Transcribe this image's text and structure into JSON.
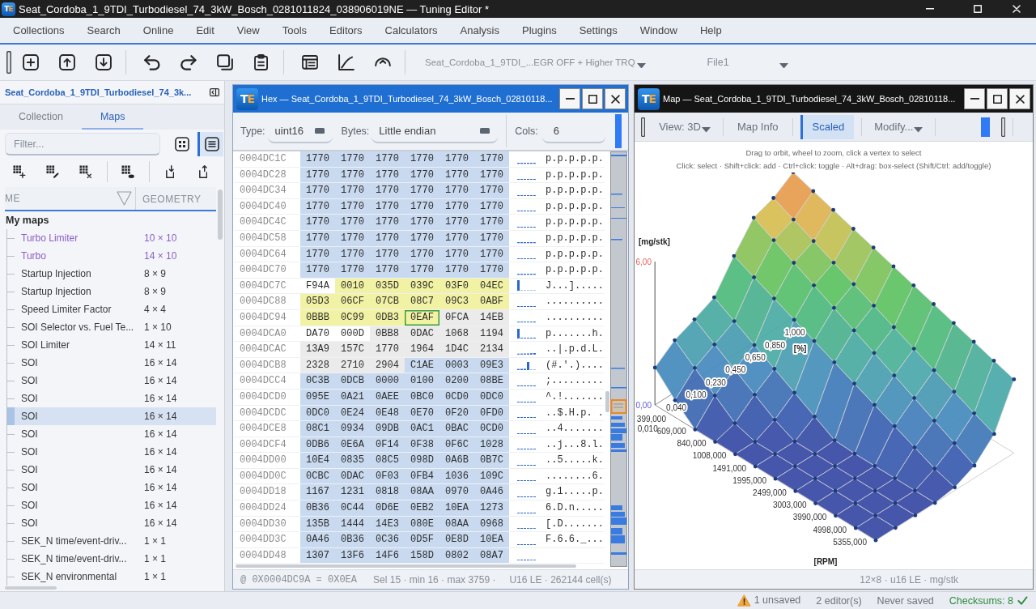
{
  "window": {
    "logo": "TE",
    "title": "Seat_Cordoba_1_9TDI_Turbodiesel_74_3kW_Bosch_0281011824_038906019NE — Tuning Editor *"
  },
  "menu": [
    "Collections",
    "Search",
    "Online",
    "Edit",
    "View",
    "Tools",
    "Editors",
    "Calculators",
    "Analysis",
    "Plugins",
    "Settings",
    "Window",
    "Help"
  ],
  "toolbar": {
    "project": "Seat_Cordoba_1_9TDI_...EGR OFF + Higher TRQ",
    "file": "File1"
  },
  "sidebar": {
    "title": "Seat_Cordoba_1_9TDI_Turbodiesel_74_3k...",
    "tabs": [
      {
        "label": "Collection",
        "selected": false
      },
      {
        "label": "Maps",
        "selected": true
      }
    ],
    "filter": {
      "placeholder": "Filter..."
    },
    "view_modes": [
      {
        "kind": "grid",
        "selected": false
      },
      {
        "kind": "list",
        "selected": true
      }
    ],
    "columns": [
      "ME",
      "GEOMETRY"
    ],
    "tree": [
      {
        "label": "My maps",
        "children": [
          {
            "name": "Turbo Limiter",
            "geometry": "10 × 10",
            "color": "#8b5fc7",
            "selected": false
          },
          {
            "name": "Turbo",
            "geometry": "14 × 10",
            "color": "#8b5fc7",
            "selected": false
          },
          {
            "name": "Startup Injection",
            "geometry": "8 × 9",
            "color": "#383838",
            "selected": false
          },
          {
            "name": "Startup Injection",
            "geometry": "8 × 9",
            "color": "#383838",
            "selected": false
          },
          {
            "name": "Speed Limiter Factor",
            "geometry": "4 × 4",
            "color": "#383838",
            "selected": false
          },
          {
            "name": "SOI Selector vs. Fuel Te...",
            "geometry": "1 × 10",
            "color": "#383838",
            "selected": false
          },
          {
            "name": "SOI Limiter",
            "geometry": "14 × 11",
            "color": "#383838",
            "selected": false
          },
          {
            "name": "SOI",
            "geometry": "16 × 14",
            "color": "#383838",
            "selected": false
          },
          {
            "name": "SOI",
            "geometry": "16 × 14",
            "color": "#383838",
            "selected": false
          },
          {
            "name": "SOI",
            "geometry": "16 × 14",
            "color": "#383838",
            "selected": false
          },
          {
            "name": "SOI",
            "geometry": "16 × 14",
            "color": "#383838",
            "selected": true
          },
          {
            "name": "SOI",
            "geometry": "16 × 14",
            "color": "#383838",
            "selected": false
          },
          {
            "name": "SOI",
            "geometry": "16 × 14",
            "color": "#383838",
            "selected": false
          },
          {
            "name": "SOI",
            "geometry": "16 × 14",
            "color": "#383838",
            "selected": false
          },
          {
            "name": "SOI",
            "geometry": "16 × 14",
            "color": "#383838",
            "selected": false
          },
          {
            "name": "SOI",
            "geometry": "16 × 14",
            "color": "#383838",
            "selected": false
          },
          {
            "name": "SOI",
            "geometry": "16 × 14",
            "color": "#383838",
            "selected": false
          },
          {
            "name": "SEK_N time/event-driv...",
            "geometry": "1 × 1",
            "color": "#383838",
            "selected": false
          },
          {
            "name": "SEK_N time/event-driv...",
            "geometry": "1 × 1",
            "color": "#383838",
            "selected": false
          },
          {
            "name": "SEK_N environmental",
            "geometry": "1 × 1",
            "color": "#383838",
            "selected": false
          }
        ]
      }
    ]
  },
  "hex": {
    "logo": "TE",
    "title": "Hex — Seat_Cordoba_1_9TDI_Turbodiesel_74_3kW_Bosch_02810118...",
    "controls": [
      {
        "kind": "dropdown",
        "label": "Type:",
        "value": "uint16"
      },
      {
        "kind": "dropdown",
        "label": "Bytes:",
        "value": "Little endian"
      },
      {
        "kind": "field",
        "label": "Cols:",
        "value": "6"
      }
    ],
    "rows": [
      {
        "address": "0004DC1C",
        "ascii": "p.p.p.p.p.",
        "cells": [
          {
            "value": "1770",
            "kind": "map",
            "selected": false,
            "cursor": false
          },
          {
            "value": "1770",
            "kind": "map",
            "selected": false,
            "cursor": false
          },
          {
            "value": "1770",
            "kind": "map",
            "selected": false,
            "cursor": false
          },
          {
            "value": "1770",
            "kind": "map",
            "selected": false,
            "cursor": false
          },
          {
            "value": "1770",
            "kind": "map",
            "selected": false,
            "cursor": false
          },
          {
            "value": "1770",
            "kind": "map",
            "selected": false,
            "cursor": false
          }
        ]
      },
      {
        "address": "0004DC28",
        "ascii": "p.p.p.p.p.",
        "cells": [
          {
            "value": "1770",
            "kind": "map",
            "selected": false,
            "cursor": false
          },
          {
            "value": "1770",
            "kind": "map",
            "selected": false,
            "cursor": false
          },
          {
            "value": "1770",
            "kind": "map",
            "selected": false,
            "cursor": false
          },
          {
            "value": "1770",
            "kind": "map",
            "selected": false,
            "cursor": false
          },
          {
            "value": "1770",
            "kind": "map",
            "selected": false,
            "cursor": false
          },
          {
            "value": "1770",
            "kind": "map",
            "selected": false,
            "cursor": false
          }
        ]
      },
      {
        "address": "0004DC34",
        "ascii": "p.p.p.p.p.",
        "cells": [
          {
            "value": "1770",
            "kind": "map",
            "selected": false,
            "cursor": false
          },
          {
            "value": "1770",
            "kind": "map",
            "selected": false,
            "cursor": false
          },
          {
            "value": "1770",
            "kind": "map",
            "selected": false,
            "cursor": false
          },
          {
            "value": "1770",
            "kind": "map",
            "selected": false,
            "cursor": false
          },
          {
            "value": "1770",
            "kind": "map",
            "selected": false,
            "cursor": false
          },
          {
            "value": "1770",
            "kind": "map",
            "selected": false,
            "cursor": false
          }
        ]
      },
      {
        "address": "0004DC40",
        "ascii": "p.p.p.p.p.",
        "cells": [
          {
            "value": "1770",
            "kind": "map",
            "selected": false,
            "cursor": false
          },
          {
            "value": "1770",
            "kind": "map",
            "selected": false,
            "cursor": false
          },
          {
            "value": "1770",
            "kind": "map",
            "selected": false,
            "cursor": false
          },
          {
            "value": "1770",
            "kind": "map",
            "selected": false,
            "cursor": false
          },
          {
            "value": "1770",
            "kind": "map",
            "selected": false,
            "cursor": false
          },
          {
            "value": "1770",
            "kind": "map",
            "selected": false,
            "cursor": false
          }
        ]
      },
      {
        "address": "0004DC4C",
        "ascii": "p.p.p.p.p.",
        "cells": [
          {
            "value": "1770",
            "kind": "map",
            "selected": false,
            "cursor": false
          },
          {
            "value": "1770",
            "kind": "map",
            "selected": false,
            "cursor": false
          },
          {
            "value": "1770",
            "kind": "map",
            "selected": false,
            "cursor": false
          },
          {
            "value": "1770",
            "kind": "map",
            "selected": false,
            "cursor": false
          },
          {
            "value": "1770",
            "kind": "map",
            "selected": false,
            "cursor": false
          },
          {
            "value": "1770",
            "kind": "map",
            "selected": false,
            "cursor": false
          }
        ]
      },
      {
        "address": "0004DC58",
        "ascii": "p.p.p.p.p.",
        "cells": [
          {
            "value": "1770",
            "kind": "map",
            "selected": false,
            "cursor": false
          },
          {
            "value": "1770",
            "kind": "map",
            "selected": false,
            "cursor": false
          },
          {
            "value": "1770",
            "kind": "map",
            "selected": false,
            "cursor": false
          },
          {
            "value": "1770",
            "kind": "map",
            "selected": false,
            "cursor": false
          },
          {
            "value": "1770",
            "kind": "map",
            "selected": false,
            "cursor": false
          },
          {
            "value": "1770",
            "kind": "map",
            "selected": false,
            "cursor": false
          }
        ]
      },
      {
        "address": "0004DC64",
        "ascii": "p.p.p.p.p.",
        "cells": [
          {
            "value": "1770",
            "kind": "map",
            "selected": false,
            "cursor": false
          },
          {
            "value": "1770",
            "kind": "map",
            "selected": false,
            "cursor": false
          },
          {
            "value": "1770",
            "kind": "map",
            "selected": false,
            "cursor": false
          },
          {
            "value": "1770",
            "kind": "map",
            "selected": false,
            "cursor": false
          },
          {
            "value": "1770",
            "kind": "map",
            "selected": false,
            "cursor": false
          },
          {
            "value": "1770",
            "kind": "map",
            "selected": false,
            "cursor": false
          }
        ]
      },
      {
        "address": "0004DC70",
        "ascii": "p.p.p.p.p.",
        "cells": [
          {
            "value": "1770",
            "kind": "map",
            "selected": false,
            "cursor": false
          },
          {
            "value": "1770",
            "kind": "map",
            "selected": false,
            "cursor": false
          },
          {
            "value": "1770",
            "kind": "map",
            "selected": false,
            "cursor": false
          },
          {
            "value": "1770",
            "kind": "map",
            "selected": false,
            "cursor": false
          },
          {
            "value": "1770",
            "kind": "map",
            "selected": false,
            "cursor": false
          },
          {
            "value": "1770",
            "kind": "map",
            "selected": false,
            "cursor": false
          }
        ]
      },
      {
        "address": "0004DC7C",
        "ascii": "J...].....",
        "cells": [
          {
            "value": "F94A",
            "kind": "plain",
            "selected": false,
            "cursor": false
          },
          {
            "value": "0010",
            "kind": "plain",
            "selected": true,
            "cursor": false
          },
          {
            "value": "035D",
            "kind": "plain",
            "selected": true,
            "cursor": false
          },
          {
            "value": "039C",
            "kind": "plain",
            "selected": true,
            "cursor": false
          },
          {
            "value": "03F0",
            "kind": "plain",
            "selected": true,
            "cursor": false
          },
          {
            "value": "04EC",
            "kind": "plain",
            "selected": true,
            "cursor": false
          }
        ]
      },
      {
        "address": "0004DC88",
        "ascii": "..........",
        "cells": [
          {
            "value": "05D3",
            "kind": "plain",
            "selected": true,
            "cursor": false
          },
          {
            "value": "06CF",
            "kind": "plain",
            "selected": true,
            "cursor": false
          },
          {
            "value": "07CB",
            "kind": "plain",
            "selected": true,
            "cursor": false
          },
          {
            "value": "08C7",
            "kind": "plain",
            "selected": true,
            "cursor": false
          },
          {
            "value": "09C3",
            "kind": "plain",
            "selected": true,
            "cursor": false
          },
          {
            "value": "0ABF",
            "kind": "plain",
            "selected": true,
            "cursor": false
          }
        ]
      },
      {
        "address": "0004DC94",
        "ascii": "..........",
        "cells": [
          {
            "value": "0BBB",
            "kind": "plain",
            "selected": true,
            "cursor": false
          },
          {
            "value": "0C99",
            "kind": "plain",
            "selected": true,
            "cursor": false
          },
          {
            "value": "0DB3",
            "kind": "plain",
            "selected": true,
            "cursor": false
          },
          {
            "value": "0EAF",
            "kind": "plain",
            "selected": true,
            "cursor": true
          },
          {
            "value": "0FCA",
            "kind": "shaded",
            "selected": false,
            "cursor": false
          },
          {
            "value": "14EB",
            "kind": "shaded",
            "selected": false,
            "cursor": false
          }
        ]
      },
      {
        "address": "0004DCA0",
        "ascii": "p.......h.",
        "cells": [
          {
            "value": "DA70",
            "kind": "plain",
            "selected": false,
            "cursor": false
          },
          {
            "value": "000D",
            "kind": "plain",
            "selected": false,
            "cursor": false
          },
          {
            "value": "0BB8",
            "kind": "shaded",
            "selected": false,
            "cursor": false
          },
          {
            "value": "0DAC",
            "kind": "shaded",
            "selected": false,
            "cursor": false
          },
          {
            "value": "1068",
            "kind": "shaded",
            "selected": false,
            "cursor": false
          },
          {
            "value": "1194",
            "kind": "shaded",
            "selected": false,
            "cursor": false
          }
        ]
      },
      {
        "address": "0004DCAC",
        "ascii": "..|.p.d.L.",
        "cells": [
          {
            "value": "13A9",
            "kind": "shaded",
            "selected": false,
            "cursor": false
          },
          {
            "value": "157C",
            "kind": "shaded",
            "selected": false,
            "cursor": false
          },
          {
            "value": "1770",
            "kind": "shaded",
            "selected": false,
            "cursor": false
          },
          {
            "value": "1964",
            "kind": "shaded",
            "selected": false,
            "cursor": false
          },
          {
            "value": "1D4C",
            "kind": "shaded",
            "selected": false,
            "cursor": false
          },
          {
            "value": "2134",
            "kind": "shaded",
            "selected": false,
            "cursor": false
          }
        ]
      },
      {
        "address": "0004DCB8",
        "ascii": "(#.'.)....",
        "cells": [
          {
            "value": "2328",
            "kind": "shaded",
            "selected": false,
            "cursor": false
          },
          {
            "value": "2710",
            "kind": "shaded",
            "selected": false,
            "cursor": false
          },
          {
            "value": "2904",
            "kind": "shaded",
            "selected": false,
            "cursor": false
          },
          {
            "value": "C1AE",
            "kind": "map",
            "selected": false,
            "cursor": false
          },
          {
            "value": "0003",
            "kind": "map",
            "selected": false,
            "cursor": false
          },
          {
            "value": "09E3",
            "kind": "map",
            "selected": false,
            "cursor": false
          }
        ]
      },
      {
        "address": "0004DCC4",
        "ascii": ";.........",
        "cells": [
          {
            "value": "0C3B",
            "kind": "map",
            "selected": false,
            "cursor": false
          },
          {
            "value": "0DCB",
            "kind": "map",
            "selected": false,
            "cursor": false
          },
          {
            "value": "0000",
            "kind": "map",
            "selected": false,
            "cursor": false
          },
          {
            "value": "0100",
            "kind": "map",
            "selected": false,
            "cursor": false
          },
          {
            "value": "0200",
            "kind": "map",
            "selected": false,
            "cursor": false
          },
          {
            "value": "08BE",
            "kind": "map",
            "selected": false,
            "cursor": false
          }
        ]
      },
      {
        "address": "0004DCD0",
        "ascii": "^.!.......",
        "cells": [
          {
            "value": "095E",
            "kind": "map",
            "selected": false,
            "cursor": false
          },
          {
            "value": "0A21",
            "kind": "map",
            "selected": false,
            "cursor": false
          },
          {
            "value": "0AEE",
            "kind": "map",
            "selected": false,
            "cursor": false
          },
          {
            "value": "0BC0",
            "kind": "map",
            "selected": false,
            "cursor": false
          },
          {
            "value": "0CD0",
            "kind": "map",
            "selected": false,
            "cursor": false
          },
          {
            "value": "0DC0",
            "kind": "map",
            "selected": false,
            "cursor": false
          }
        ]
      },
      {
        "address": "0004DCDC",
        "ascii": "..$.H.p. .",
        "cells": [
          {
            "value": "0DC0",
            "kind": "map",
            "selected": false,
            "cursor": false
          },
          {
            "value": "0E24",
            "kind": "map",
            "selected": false,
            "cursor": false
          },
          {
            "value": "0E48",
            "kind": "map",
            "selected": false,
            "cursor": false
          },
          {
            "value": "0E70",
            "kind": "map",
            "selected": false,
            "cursor": false
          },
          {
            "value": "0F20",
            "kind": "map",
            "selected": false,
            "cursor": false
          },
          {
            "value": "0FD0",
            "kind": "map",
            "selected": false,
            "cursor": false
          }
        ]
      },
      {
        "address": "0004DCE8",
        "ascii": "..4.......",
        "cells": [
          {
            "value": "08C1",
            "kind": "map",
            "selected": false,
            "cursor": false
          },
          {
            "value": "0934",
            "kind": "map",
            "selected": false,
            "cursor": false
          },
          {
            "value": "09DB",
            "kind": "map",
            "selected": false,
            "cursor": false
          },
          {
            "value": "0AC1",
            "kind": "map",
            "selected": false,
            "cursor": false
          },
          {
            "value": "0BAC",
            "kind": "map",
            "selected": false,
            "cursor": false
          },
          {
            "value": "0CD0",
            "kind": "map",
            "selected": false,
            "cursor": false
          }
        ]
      },
      {
        "address": "0004DCF4",
        "ascii": "..j...8.l.",
        "cells": [
          {
            "value": "0DB6",
            "kind": "map",
            "selected": false,
            "cursor": false
          },
          {
            "value": "0E6A",
            "kind": "map",
            "selected": false,
            "cursor": false
          },
          {
            "value": "0F14",
            "kind": "map",
            "selected": false,
            "cursor": false
          },
          {
            "value": "0F38",
            "kind": "map",
            "selected": false,
            "cursor": false
          },
          {
            "value": "0F6C",
            "kind": "map",
            "selected": false,
            "cursor": false
          },
          {
            "value": "1028",
            "kind": "map",
            "selected": false,
            "cursor": false
          }
        ]
      },
      {
        "address": "0004DD00",
        "ascii": "..5.....k.",
        "cells": [
          {
            "value": "10E4",
            "kind": "map",
            "selected": false,
            "cursor": false
          },
          {
            "value": "0835",
            "kind": "map",
            "selected": false,
            "cursor": false
          },
          {
            "value": "08C5",
            "kind": "map",
            "selected": false,
            "cursor": false
          },
          {
            "value": "098D",
            "kind": "map",
            "selected": false,
            "cursor": false
          },
          {
            "value": "0A6B",
            "kind": "map",
            "selected": false,
            "cursor": false
          },
          {
            "value": "0B7C",
            "kind": "map",
            "selected": false,
            "cursor": false
          }
        ]
      },
      {
        "address": "0004DD0C",
        "ascii": "........6.",
        "cells": [
          {
            "value": "0CBC",
            "kind": "map",
            "selected": false,
            "cursor": false
          },
          {
            "value": "0DAC",
            "kind": "map",
            "selected": false,
            "cursor": false
          },
          {
            "value": "0F03",
            "kind": "map",
            "selected": false,
            "cursor": false
          },
          {
            "value": "0FB4",
            "kind": "map",
            "selected": false,
            "cursor": false
          },
          {
            "value": "1036",
            "kind": "map",
            "selected": false,
            "cursor": false
          },
          {
            "value": "109C",
            "kind": "map",
            "selected": false,
            "cursor": false
          }
        ]
      },
      {
        "address": "0004DD18",
        "ascii": "g.1.....p.",
        "cells": [
          {
            "value": "1167",
            "kind": "map",
            "selected": false,
            "cursor": false
          },
          {
            "value": "1231",
            "kind": "map",
            "selected": false,
            "cursor": false
          },
          {
            "value": "0818",
            "kind": "map",
            "selected": false,
            "cursor": false
          },
          {
            "value": "08AA",
            "kind": "map",
            "selected": false,
            "cursor": false
          },
          {
            "value": "0970",
            "kind": "map",
            "selected": false,
            "cursor": false
          },
          {
            "value": "0A46",
            "kind": "map",
            "selected": false,
            "cursor": false
          }
        ]
      },
      {
        "address": "0004DD24",
        "ascii": "6.D.n.....",
        "cells": [
          {
            "value": "0B36",
            "kind": "map",
            "selected": false,
            "cursor": false
          },
          {
            "value": "0C44",
            "kind": "map",
            "selected": false,
            "cursor": false
          },
          {
            "value": "0D6E",
            "kind": "map",
            "selected": false,
            "cursor": false
          },
          {
            "value": "0EB2",
            "kind": "map",
            "selected": false,
            "cursor": false
          },
          {
            "value": "10EA",
            "kind": "map",
            "selected": false,
            "cursor": false
          },
          {
            "value": "1273",
            "kind": "map",
            "selected": false,
            "cursor": false
          }
        ]
      },
      {
        "address": "0004DD30",
        "ascii": "[.D.......",
        "cells": [
          {
            "value": "135B",
            "kind": "map",
            "selected": false,
            "cursor": false
          },
          {
            "value": "1444",
            "kind": "map",
            "selected": false,
            "cursor": false
          },
          {
            "value": "14E3",
            "kind": "map",
            "selected": false,
            "cursor": false
          },
          {
            "value": "080E",
            "kind": "map",
            "selected": false,
            "cursor": false
          },
          {
            "value": "08AA",
            "kind": "map",
            "selected": false,
            "cursor": false
          },
          {
            "value": "0968",
            "kind": "map",
            "selected": false,
            "cursor": false
          }
        ]
      },
      {
        "address": "0004DD3C",
        "ascii": "F.6.6._...",
        "cells": [
          {
            "value": "0A46",
            "kind": "map",
            "selected": false,
            "cursor": false
          },
          {
            "value": "0B36",
            "kind": "map",
            "selected": false,
            "cursor": false
          },
          {
            "value": "0C36",
            "kind": "map",
            "selected": false,
            "cursor": false
          },
          {
            "value": "0D5F",
            "kind": "map",
            "selected": false,
            "cursor": false
          },
          {
            "value": "0E8D",
            "kind": "map",
            "selected": false,
            "cursor": false
          },
          {
            "value": "10EA",
            "kind": "map",
            "selected": false,
            "cursor": false
          }
        ]
      },
      {
        "address": "0004DD48",
        "cells": [
          {
            "value": "1307",
            "kind": "map",
            "selected": false,
            "cursor": false
          },
          {
            "value": "13F6",
            "kind": "map",
            "selected": false,
            "cursor": false
          },
          {
            "value": "14F6",
            "kind": "map",
            "selected": false,
            "cursor": false
          },
          {
            "value": "158D",
            "kind": "map",
            "selected": false,
            "cursor": false
          },
          {
            "value": "0802",
            "kind": "map",
            "selected": false,
            "cursor": false
          },
          {
            "value": "08A7",
            "kind": "map",
            "selected": false,
            "cursor": false
          }
        ]
      }
    ],
    "status": [
      "@ 0X0004DC9A = 0X0EA",
      "Sel 15 · min 16 · max 3759 ·",
      "U16 LE · 262144 cell(s)"
    ]
  },
  "map": {
    "logo": "TE",
    "title": "Map — Seat_Cordoba_1_9TDI_Turbodiesel_74_3kW_Bosch_02810118...",
    "toolbar": [
      {
        "kind": "dropdown",
        "label": "View: 3D"
      },
      {
        "kind": "button",
        "label": "Map Info"
      },
      {
        "kind": "toggle",
        "label": "Scaled",
        "on": true
      },
      {
        "kind": "dropdown",
        "label": "Modify..."
      }
    ],
    "hints": [
      "Drag to orbit, wheel to zoom, click a vertex to select",
      "Click: select · Shift+click: add · Ctrl+click: toggle · Alt+drag: box-select (Shift/Ctrl: add/toggle)"
    ],
    "plot": {
      "z_label": "[mg/stk]",
      "z_ticks": [
        "6,00",
        "0,00"
      ],
      "x_label": "[RPM]",
      "x_ticks": [
        "399,000",
        "609,000",
        "840,000",
        "1008,000",
        "1491,000",
        "1995,000",
        "2499,000",
        "3003,000",
        "3990,000",
        "4998,000",
        "5355,000"
      ],
      "y_label": "[%]",
      "y_ticks": [
        "0,010",
        "0,040",
        "0,100",
        "0,230",
        "0,450",
        "0,650",
        "0,850",
        "1,000"
      ]
    },
    "footer": "12×8 · u16 LE · mg/stk"
  },
  "status_bar": [
    {
      "kind": "warning",
      "text": "1 unsaved"
    },
    {
      "kind": "plain",
      "text": "2 editor(s)"
    },
    {
      "kind": "plain",
      "text": "Never saved"
    },
    {
      "kind": "ok",
      "text": "Checksums: 8"
    }
  ]
}
